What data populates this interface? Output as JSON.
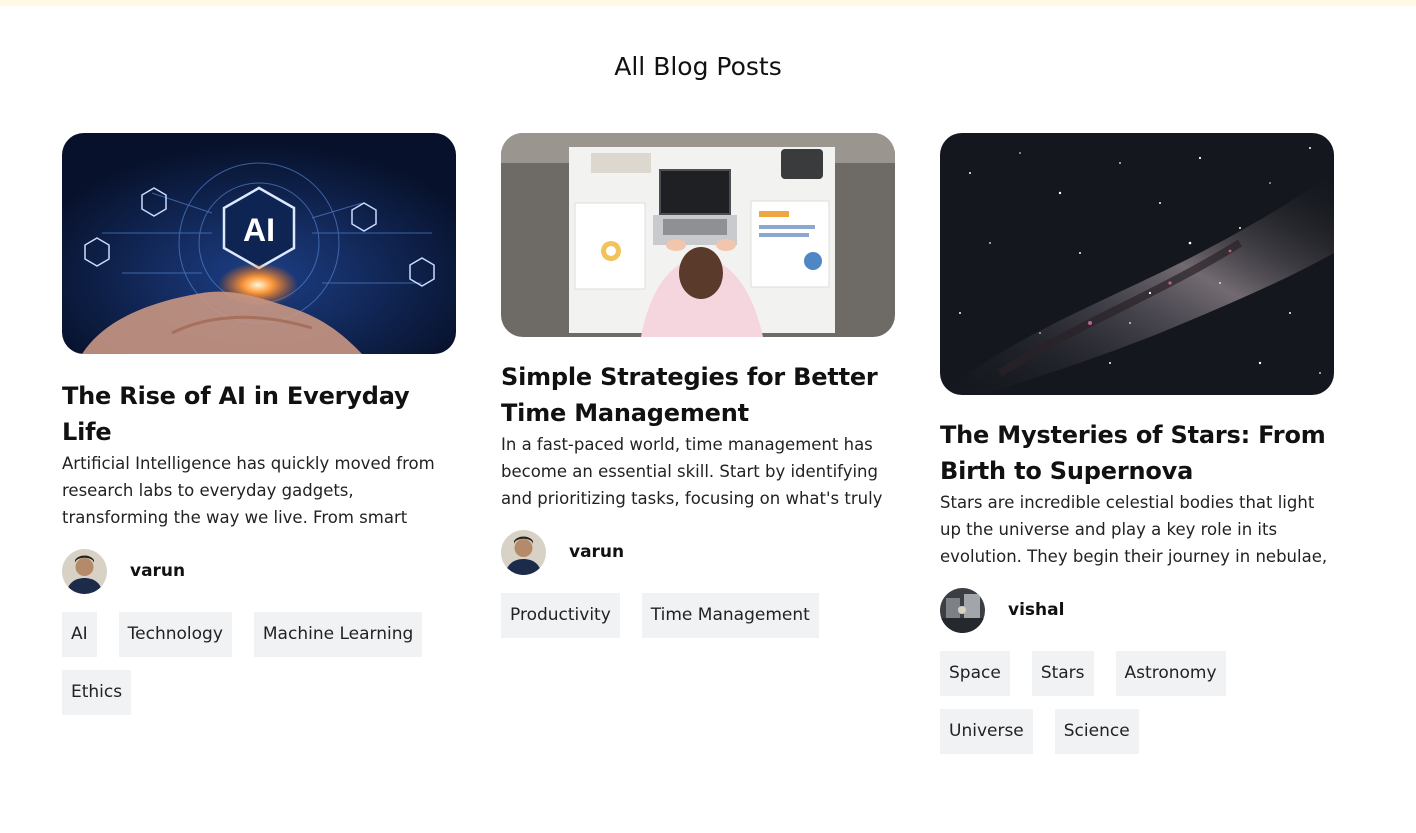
{
  "page": {
    "title": "All Blog Posts"
  },
  "posts": [
    {
      "title": "The Rise of AI in Everyday Life",
      "excerpt": "Artificial Intelligence has quickly moved from research labs to everyday gadgets, transforming the way we live. From smart",
      "author": "varun",
      "tags": [
        "AI",
        "Technology",
        "Machine Learning",
        "Ethics"
      ],
      "cover_badge": "AI"
    },
    {
      "title": "Simple Strategies for Better Time Management",
      "excerpt": "In a fast-paced world, time management has become an essential skill. Start by identifying and prioritizing tasks, focusing on what's truly",
      "author": "varun",
      "tags": [
        "Productivity",
        "Time Management"
      ]
    },
    {
      "title": "The Mysteries of Stars: From Birth to Supernova",
      "excerpt": "Stars are incredible celestial bodies that light up the universe and play a key role in its evolution. They begin their journey in nebulae,",
      "author": "vishal",
      "tags": [
        "Space",
        "Stars",
        "Astronomy",
        "Universe",
        "Science"
      ]
    }
  ],
  "colors": {
    "top_strip": "#fdf9e5",
    "tag_background": "#f1f2f3",
    "ai_cover_background": "#0b1a3e",
    "space_cover_background": "#14171d"
  }
}
